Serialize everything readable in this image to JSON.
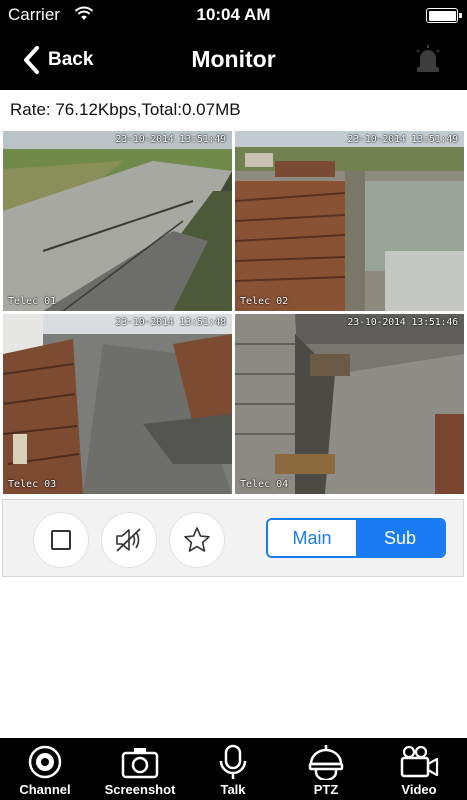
{
  "status_bar": {
    "carrier": "Carrier",
    "time": "10:04 AM"
  },
  "nav": {
    "back_label": "Back",
    "title": "Monitor"
  },
  "rate_text": "Rate: 76.12Kbps,Total:0.07MB",
  "cameras": [
    {
      "name": "Telec 01",
      "timestamp": "23-10-2014 13:51:49",
      "selected": true
    },
    {
      "name": "Telec 02",
      "timestamp": "23-10-2014 13:51:49",
      "selected": false
    },
    {
      "name": "Telec 03",
      "timestamp": "23-10-2014 13:51:48",
      "selected": false
    },
    {
      "name": "Telec 04",
      "timestamp": "23-10-2014 13:51:46",
      "selected": false
    }
  ],
  "stream_toggle": {
    "main_label": "Main",
    "sub_label": "Sub",
    "selected": "Sub"
  },
  "tabs": [
    {
      "label": "Channel",
      "icon": "channel-icon"
    },
    {
      "label": "Screenshot",
      "icon": "camera-icon"
    },
    {
      "label": "Talk",
      "icon": "microphone-icon"
    },
    {
      "label": "PTZ",
      "icon": "ptz-icon"
    },
    {
      "label": "Video",
      "icon": "video-camera-icon"
    }
  ],
  "colors": {
    "accent": "#1a7cf5",
    "selection": "#5fe0ff",
    "bar_bg": "#000000"
  }
}
